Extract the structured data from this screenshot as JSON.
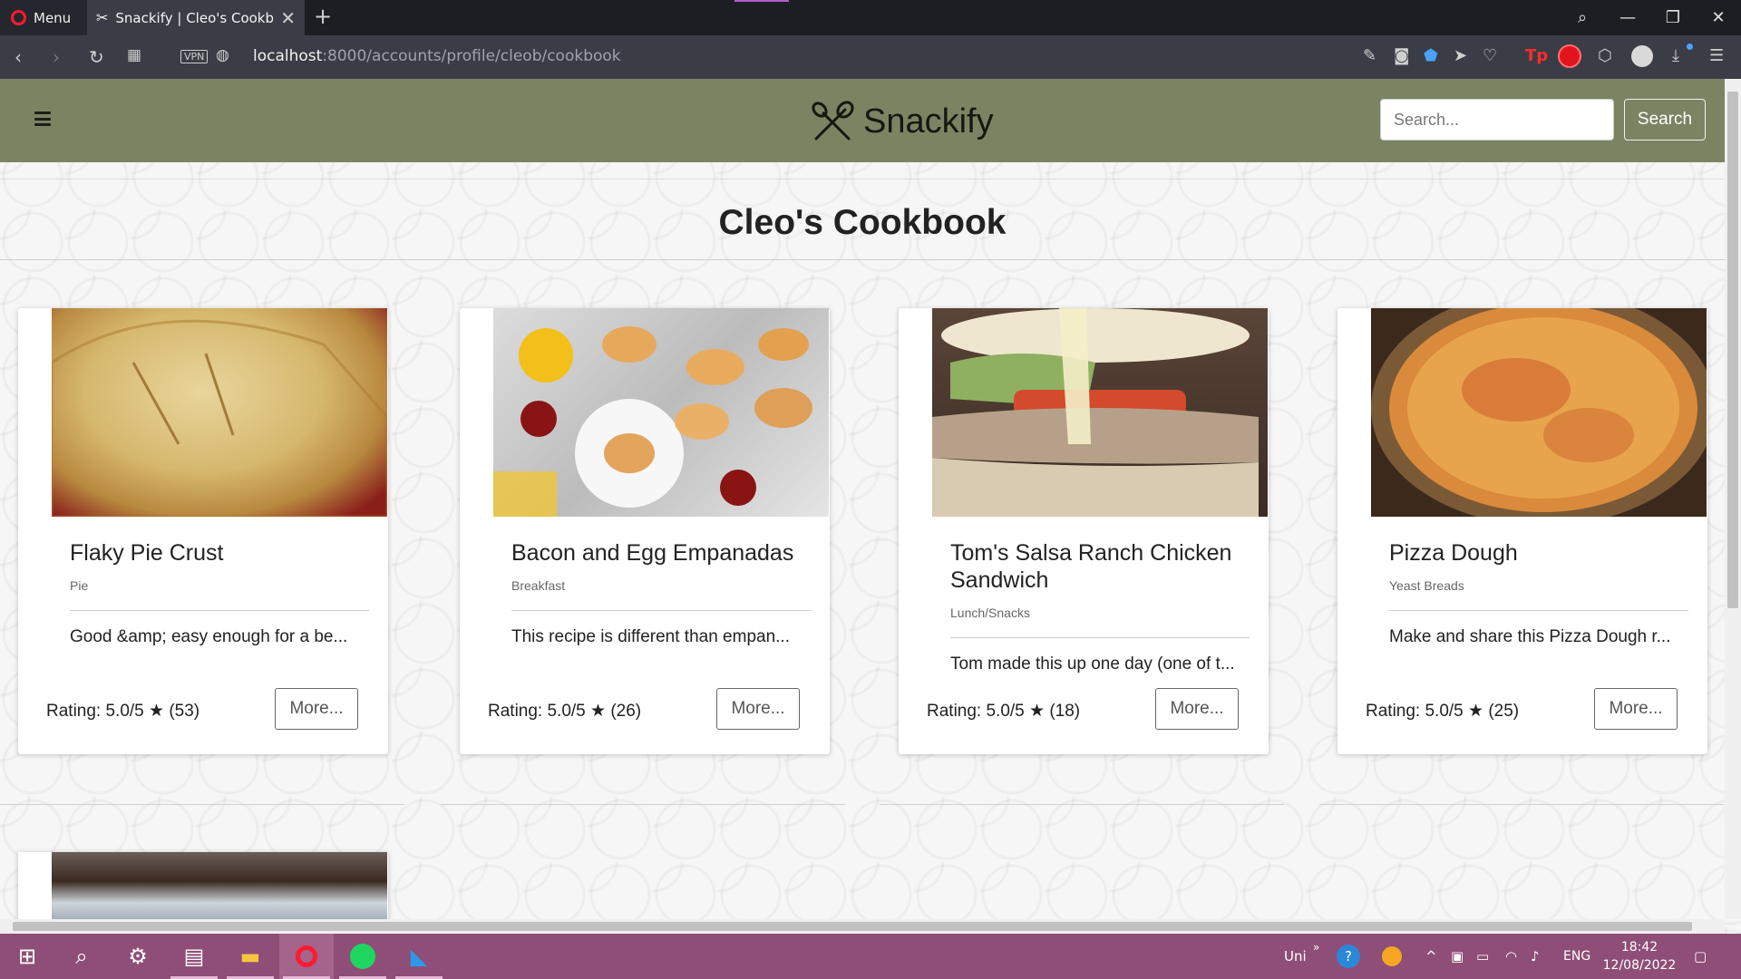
{
  "browser": {
    "menu_label": "Menu",
    "tab_title": "Snackify | Cleo's Cookbook",
    "url_host": "localhost",
    "url_path": ":8000/accounts/profile/cleob/cookbook",
    "vpn_label": "VPN"
  },
  "site": {
    "brand": "Snackify",
    "search_placeholder": "Search...",
    "search_button": "Search",
    "page_title": "Cleo's Cookbook"
  },
  "recipes": [
    {
      "title": "Flaky Pie Crust",
      "category": "Pie",
      "description": "Good &amp; easy enough for a be...",
      "rating": "Rating: 5.0/5 ★ (53)",
      "more": "More..."
    },
    {
      "title": "Bacon and Egg Empanadas",
      "category": "Breakfast",
      "description": "This recipe is different than empan...",
      "rating": "Rating: 5.0/5 ★ (26)",
      "more": "More..."
    },
    {
      "title": "Tom's Salsa Ranch Chicken Sandwich",
      "category": "Lunch/Snacks",
      "description": "Tom made this up one day (one of t...",
      "rating": "Rating: 5.0/5 ★ (18)",
      "more": "More..."
    },
    {
      "title": "Pizza Dough",
      "category": "Yeast Breads",
      "description": "Make and share this Pizza Dough r...",
      "rating": "Rating: 5.0/5 ★ (25)",
      "more": "More..."
    }
  ],
  "taskbar": {
    "tray_user": "Uni",
    "language": "ENG",
    "time": "18:42",
    "date": "12/08/2022"
  }
}
